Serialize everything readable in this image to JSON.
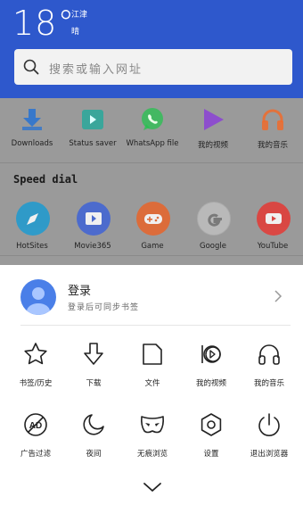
{
  "weather": {
    "temperature": "18°",
    "city": "江津",
    "condition": "晴"
  },
  "search": {
    "placeholder": "搜索或输入网址",
    "icon": "search-icon"
  },
  "apps": [
    {
      "label": "Downloads",
      "icon": "download-icon",
      "color": "#1f6fd6"
    },
    {
      "label": "Status saver",
      "icon": "status-saver-icon",
      "color": "#19a99b"
    },
    {
      "label": "WhatsApp file",
      "icon": "whatsapp-icon",
      "color": "#25c14f"
    },
    {
      "label": "我的视频",
      "icon": "video-play-icon",
      "color": "#8a3bd9"
    },
    {
      "label": "我的音乐",
      "icon": "headphones-icon",
      "color": "#f06b2b"
    }
  ],
  "speed_dial": {
    "title": "Speed dial",
    "items": [
      {
        "label": "HotSites",
        "icon": "compass-icon",
        "color": "#1d9bd1"
      },
      {
        "label": "Movie365",
        "icon": "movie-icon",
        "color": "#3f63d6"
      },
      {
        "label": "Game",
        "icon": "gamepad-icon",
        "color": "#e8642a"
      },
      {
        "label": "Google",
        "icon": "google-icon",
        "color": "#f5f5f5"
      },
      {
        "label": "YouTube",
        "icon": "youtube-icon",
        "color": "#e53935"
      }
    ]
  },
  "account": {
    "title": "登录",
    "subtitle": "登录后可同步书签"
  },
  "menu": [
    {
      "label": "书签/历史",
      "icon": "star-icon"
    },
    {
      "label": "下载",
      "icon": "download-arrow-icon"
    },
    {
      "label": "文件",
      "icon": "file-icon"
    },
    {
      "label": "我的视频",
      "icon": "video-icon"
    },
    {
      "label": "我的音乐",
      "icon": "headphones-icon"
    },
    {
      "label": "广告过滤",
      "icon": "ad-block-icon"
    },
    {
      "label": "夜间",
      "icon": "moon-icon"
    },
    {
      "label": "无痕浏览",
      "icon": "mask-icon"
    },
    {
      "label": "设置",
      "icon": "settings-icon"
    },
    {
      "label": "退出浏览器",
      "icon": "power-icon"
    }
  ],
  "colors": {
    "header_blue": "#2e58cc",
    "backdrop_gray": "#9a9a9a",
    "avatar_blue": "#4a7fe8"
  }
}
